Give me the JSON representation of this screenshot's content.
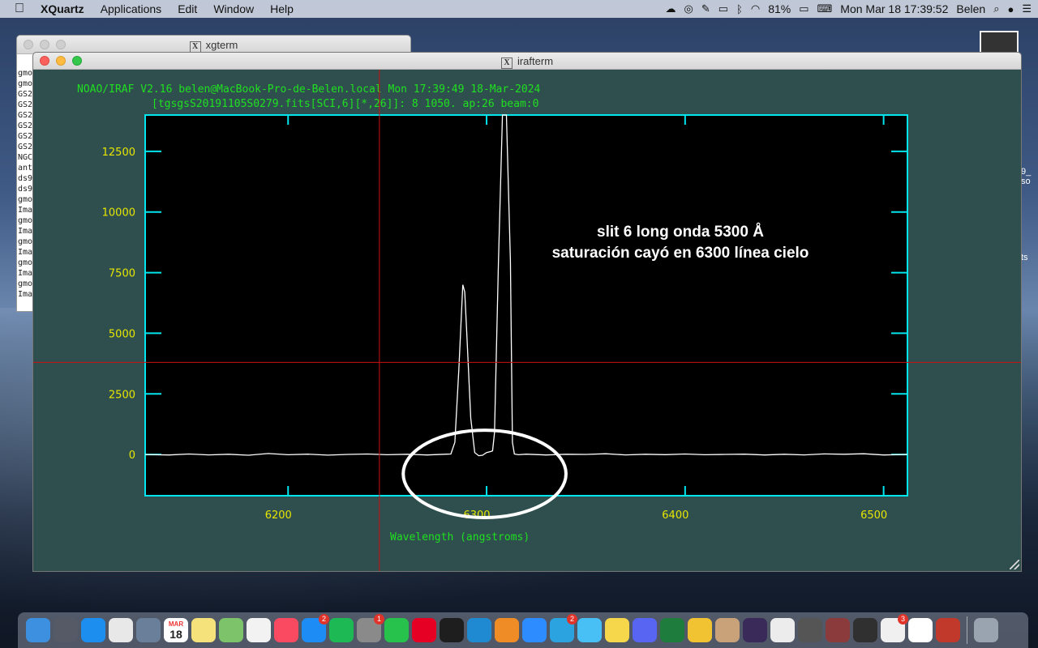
{
  "menubar": {
    "apple": "",
    "app_name": "XQuartz",
    "menus": [
      "Applications",
      "Edit",
      "Window",
      "Help"
    ],
    "battery": "81%",
    "datetime": "Mon Mar 18  17:39:52",
    "user": "Belen"
  },
  "xgterm": {
    "title": "xgterm",
    "lines": [
      "gmo",
      "gmo",
      "GS2",
      "GS2",
      "GS2",
      "GS2",
      "GS2",
      "GS2",
      "NGC",
      "ant",
      "ds9",
      "ds9",
      "gmo",
      "Ima",
      "gmo",
      "Ima",
      "gmo",
      "Ima",
      "gmo",
      "Ima",
      "gmo",
      "Ima"
    ]
  },
  "irafterm": {
    "title": "irafterm",
    "header_line1": "NOAO/IRAF V2.16 belen@MacBook-Pro-de-Belen.local Mon 17:39:49 18-Mar-2024",
    "header_line2": "[tgsgsS20191105S0279.fits[SCI,6][*,26]]: 8 1050. ap:26 beam:0",
    "annotation_line1": "slit 6 long onda 5300 Å",
    "annotation_line2": "saturación cayó en 6300 línea cielo",
    "xlabel": "Wavelength (angstroms)"
  },
  "chart_data": {
    "type": "line",
    "xlabel": "Wavelength (angstroms)",
    "xlim": [
      6128,
      6512
    ],
    "ylim": [
      -1700,
      14000
    ],
    "xticks": [
      6200,
      6300,
      6400,
      6500
    ],
    "yticks": [
      0,
      2500,
      5000,
      7500,
      10000,
      12500
    ],
    "x": [
      6128,
      6140,
      6150,
      6160,
      6170,
      6180,
      6190,
      6200,
      6210,
      6220,
      6230,
      6240,
      6250,
      6260,
      6270,
      6280,
      6282,
      6284,
      6286,
      6288,
      6289,
      6290,
      6292,
      6294,
      6296,
      6298,
      6300,
      6302,
      6303,
      6304,
      6306,
      6308,
      6309,
      6310,
      6312,
      6313,
      6314,
      6316,
      6320,
      6330,
      6340,
      6350,
      6360,
      6370,
      6380,
      6390,
      6400,
      6410,
      6420,
      6430,
      6440,
      6450,
      6460,
      6470,
      6480,
      6490,
      6500,
      6512
    ],
    "y": [
      0,
      -20,
      20,
      -15,
      10,
      -30,
      40,
      -10,
      15,
      -25,
      5,
      20,
      -10,
      10,
      -20,
      15,
      20,
      500,
      3500,
      7000,
      6700,
      5000,
      1500,
      80,
      -50,
      -30,
      80,
      120,
      150,
      900,
      8000,
      14000,
      14000,
      14000,
      8000,
      500,
      20,
      -10,
      15,
      -20,
      10,
      5,
      30,
      -15,
      10,
      -5,
      20,
      -10,
      5,
      15,
      -20,
      10,
      -15,
      25,
      10,
      30,
      -20,
      5
    ],
    "cursor": {
      "x": 6246,
      "y": 3800
    },
    "highlight_circle": {
      "x": 6299,
      "y": -800,
      "rx": 41,
      "ry": 1800
    }
  },
  "dock": {
    "calendar_month": "MAR",
    "calendar_day": "18",
    "badges": {
      "appstore": "2",
      "sysprefs": "1",
      "telegram": "2",
      "extra": "3"
    },
    "apps": [
      {
        "name": "Finder",
        "color": "#3d8fe0"
      },
      {
        "name": "Launchpad",
        "color": "#555a66"
      },
      {
        "name": "Safari",
        "color": "#1b8ef0"
      },
      {
        "name": "Chrome",
        "color": "#e8e8e8"
      },
      {
        "name": "Preview",
        "color": "#6a7f9a"
      },
      {
        "name": "Calendar",
        "color": "#ffffff"
      },
      {
        "name": "Notes",
        "color": "#f5e27a"
      },
      {
        "name": "Maps",
        "color": "#7cc36a"
      },
      {
        "name": "Photos",
        "color": "#f2f2f2"
      },
      {
        "name": "Music",
        "color": "#fa4a62"
      },
      {
        "name": "App Store",
        "color": "#1d8cf5"
      },
      {
        "name": "Spotify",
        "color": "#1db954"
      },
      {
        "name": "System Preferences",
        "color": "#8a8a8a"
      },
      {
        "name": "WhatsApp",
        "color": "#27c24c"
      },
      {
        "name": "Pinterest",
        "color": "#e60023"
      },
      {
        "name": "Terminal",
        "color": "#1e1e1e"
      },
      {
        "name": "VS Code",
        "color": "#1f8ad2"
      },
      {
        "name": "Sublime Text",
        "color": "#f08c26"
      },
      {
        "name": "Zoom",
        "color": "#2d8cff"
      },
      {
        "name": "Telegram",
        "color": "#2aa3e0"
      },
      {
        "name": "Messages",
        "color": "#49c0f5"
      },
      {
        "name": "Stickies",
        "color": "#f6d64b"
      },
      {
        "name": "Discord",
        "color": "#5865f2"
      },
      {
        "name": "Circle",
        "color": "#1e7c3c"
      },
      {
        "name": "Cat App",
        "color": "#f1c232"
      },
      {
        "name": "Sheets",
        "color": "#c9a27a"
      },
      {
        "name": "Galaxy",
        "color": "#3a2a5a"
      },
      {
        "name": "Document",
        "color": "#ececec"
      },
      {
        "name": "Observing Tool",
        "color": "#555555"
      },
      {
        "name": "Telescope",
        "color": "#8b3b3b"
      },
      {
        "name": "DS9",
        "color": "#303030"
      },
      {
        "name": "Python",
        "color": "#f0f0f0"
      },
      {
        "name": "Notion",
        "color": "#ffffff"
      },
      {
        "name": "Red App",
        "color": "#c0392b"
      },
      {
        "name": "Trash",
        "color": "#9aa4b0"
      }
    ]
  }
}
